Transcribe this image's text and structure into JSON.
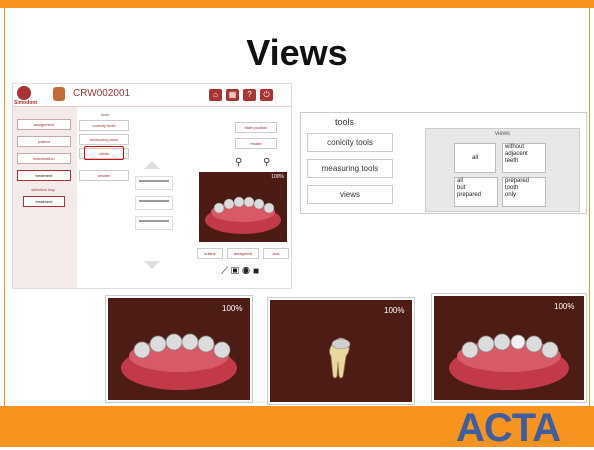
{
  "slide": {
    "title": "Views",
    "logo_text": "ACTA",
    "accent_color": "#f7941d",
    "logo_color": "#3d5ea0"
  },
  "app": {
    "logo_text": "Simodont",
    "case_id": "CRW002001",
    "header_buttons": [
      "home-icon",
      "settings-icon",
      "help-icon",
      "power-icon"
    ],
    "sidebar": [
      {
        "label": "assignment",
        "active": false
      },
      {
        "label": "patient",
        "active": false
      },
      {
        "label": "examination",
        "active": false
      },
      {
        "label": "treatment",
        "active": true
      },
      {
        "label": "selection tray",
        "active": false
      },
      {
        "label": "treatment",
        "active": false
      }
    ],
    "tools_heading": "tools",
    "tools": [
      "conicity tools",
      "measuring tools",
      "views",
      "answer"
    ],
    "right_buttons": [
      "start position",
      "restart"
    ],
    "view_buttons": [
      "outline",
      "antagonist",
      "axis"
    ],
    "view_percent": "100%",
    "bottom_icons": [
      "tooth-tool-icon",
      "save-icon",
      "camera-icon",
      "video-icon"
    ]
  },
  "tools_panel": {
    "heading": "tools",
    "buttons": [
      "conicity tools",
      "measuring tools",
      "views"
    ],
    "views_heading": "views",
    "options": [
      {
        "lines": [
          "all"
        ]
      },
      {
        "lines": [
          "without",
          "adjacent",
          "teeth"
        ]
      },
      {
        "lines": [
          "all",
          "but",
          "prepared"
        ]
      },
      {
        "lines": [
          "prepared",
          "tooth",
          "only"
        ]
      }
    ]
  },
  "thumbnails": [
    {
      "percent": "100%"
    },
    {
      "percent": "100%"
    },
    {
      "percent": "100%"
    }
  ]
}
